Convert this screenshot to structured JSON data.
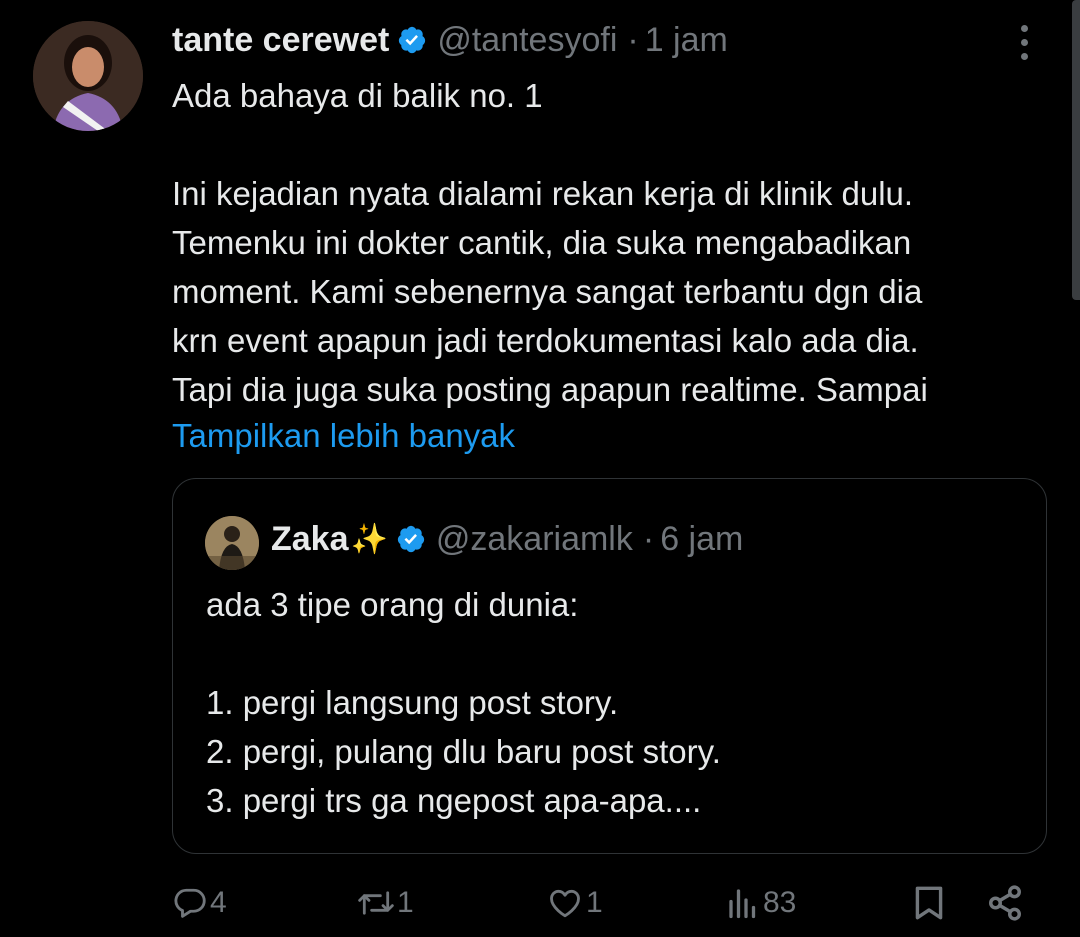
{
  "post": {
    "author_name": "tante cerewet",
    "handle": "@tantesyofi",
    "separator": "·",
    "time": "1 jam",
    "text_lines": [
      "Ada bahaya di balik no. 1",
      "",
      "Ini kejadian nyata dialami rekan kerja di klinik dulu.",
      "Temenku ini dokter cantik, dia suka mengabadikan",
      "moment. Kami sebenernya sangat terbantu dgn dia",
      "krn event apapun jadi terdokumentasi kalo ada dia.",
      "Tapi dia juga suka posting apapun realtime. Sampai"
    ],
    "show_more": "Tampilkan lebih banyak"
  },
  "quoted": {
    "author_name": "Zaka",
    "emoji": "✨",
    "handle": "@zakariamlk",
    "separator": "·",
    "time": "6 jam",
    "text_lines": [
      "ada 3 tipe orang di dunia:",
      "",
      "1. pergi langsung post story.",
      "2. pergi, pulang dlu baru post story.",
      "3. pergi trs ga ngepost apa-apa...."
    ]
  },
  "actions": {
    "replies": "4",
    "reposts": "1",
    "likes": "1",
    "views": "83"
  },
  "colors": {
    "background": "#000000",
    "text": "#e7e9ea",
    "secondary": "#71767b",
    "link": "#1d9bf0",
    "verified": "#1d9bf0",
    "border": "#2f3336"
  },
  "icons": [
    "verified-badge-icon",
    "more-icon",
    "reply-icon",
    "repost-icon",
    "like-icon",
    "views-icon",
    "bookmark-icon",
    "share-icon"
  ]
}
